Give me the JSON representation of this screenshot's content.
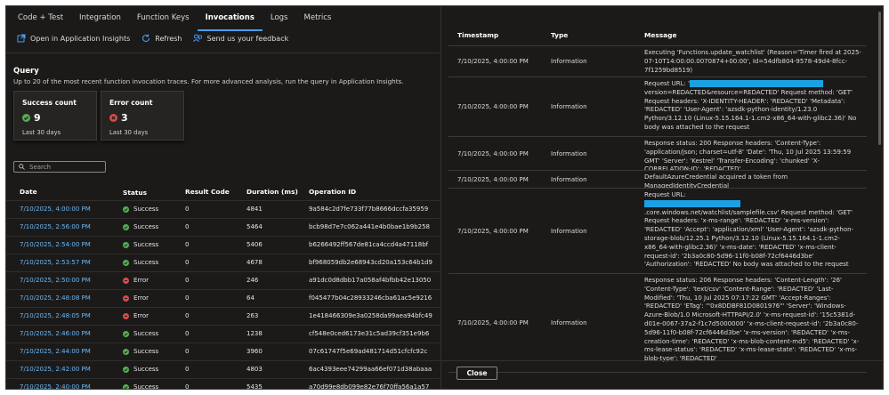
{
  "tabs": [
    "Code + Test",
    "Integration",
    "Function Keys",
    "Invocations",
    "Logs",
    "Metrics"
  ],
  "active_tab": 3,
  "toolbar": {
    "open_insights": "Open in Application Insights",
    "refresh": "Refresh",
    "feedback": "Send us your feedback"
  },
  "query": {
    "title": "Query",
    "description": "Up to 20 of the most recent function invocation traces. For more advanced analysis, run the query in Application Insights."
  },
  "cards": {
    "success": {
      "title": "Success count",
      "count": "9",
      "foot": "Last 30 days"
    },
    "error": {
      "title": "Error count",
      "count": "3",
      "foot": "Last 30 days"
    }
  },
  "search": {
    "placeholder": "Search"
  },
  "invocations": {
    "headers": [
      "Date",
      "Status",
      "Result Code",
      "Duration (ms)",
      "Operation ID"
    ],
    "rows": [
      {
        "date": "7/10/2025, 4:00:00 PM",
        "status": "Success",
        "code": "0",
        "duration": "4841",
        "op": "9a584c2d7fe733f77b8666dccfa35959"
      },
      {
        "date": "7/10/2025, 2:56:00 PM",
        "status": "Success",
        "code": "0",
        "duration": "5464",
        "op": "bcb98d7e7c062a441e4b0bae1b9b258"
      },
      {
        "date": "7/10/2025, 2:54:00 PM",
        "status": "Success",
        "code": "0",
        "duration": "5406",
        "op": "b6266492ff567de81ca4ccd4a47118bf"
      },
      {
        "date": "7/10/2025, 2:53:57 PM",
        "status": "Success",
        "code": "0",
        "duration": "4678",
        "op": "bf968059db2e68943cd20a153c64b1d9"
      },
      {
        "date": "7/10/2025, 2:50:00 PM",
        "status": "Error",
        "code": "0",
        "duration": "246",
        "op": "a91dc0d8dbb17a058af4bfbb42e13050"
      },
      {
        "date": "7/10/2025, 2:48:08 PM",
        "status": "Error",
        "code": "0",
        "duration": "64",
        "op": "f045477b04c28933246cba61ac5e9216"
      },
      {
        "date": "7/10/2025, 2:48:05 PM",
        "status": "Error",
        "code": "0",
        "duration": "263",
        "op": "1e418466309e3a0258da99aea94bfc49"
      },
      {
        "date": "7/10/2025, 2:46:00 PM",
        "status": "Success",
        "code": "0",
        "duration": "1238",
        "op": "cf548e0ced6173e31c5ad39cf351e9b6"
      },
      {
        "date": "7/10/2025, 2:44:00 PM",
        "status": "Success",
        "code": "0",
        "duration": "3960",
        "op": "07c61747f5e69ad481714d51cfcfc92c"
      },
      {
        "date": "7/10/2025, 2:42:00 PM",
        "status": "Success",
        "code": "0",
        "duration": "4803",
        "op": "6ac4393eee74299aa66ef071d38abaaa"
      },
      {
        "date": "7/10/2025, 2:40:00 PM",
        "status": "Success",
        "code": "0",
        "duration": "5435",
        "op": "a70d99e8db099e82e76f70ffa56a1a57"
      }
    ]
  },
  "colors": {
    "accent": "#479ef5",
    "link": "#6cb8f6",
    "success": "#54b054",
    "error": "#e04747",
    "redaction": "#1ba1e2"
  },
  "traces": {
    "headers": [
      "Timestamp",
      "Type",
      "Message"
    ],
    "rows": [
      {
        "ts": "7/10/2025, 4:00:00 PM",
        "type": "Information",
        "msg": "Executing 'Functions.update_watchlist' (Reason='Timer fired at 2025-07-10T14:00:00.0070874+00:00', Id=54dfb804-9578-49d4-8fcc-7f1259bd8519)"
      },
      {
        "ts": "7/10/2025, 4:00:00 PM",
        "type": "Information",
        "msg_pre": "Request URL: '",
        "msg": "version=REDACTED&resource=REDACTED' Request method: 'GET' Request headers: 'X-IDENTITY-HEADER': 'REDACTED' 'Metadata': 'REDACTED' 'User-Agent': 'azsdk-python-identity/1.23.0 Python/3.12.10 (Linux-5.15.164.1-1.cm2-x86_64-with-glibc2.36)' No body was attached to the request"
      },
      {
        "ts": "7/10/2025, 4:00:00 PM",
        "type": "Information",
        "msg": "Response status: 200 Response headers: 'Content-Type': 'application/json; charset=utf-8' 'Date': 'Thu, 10 Jul 2025 13:59:59 GMT' 'Server': 'Kestrel' 'Transfer-Encoding': 'chunked' 'X-CORRELATION-ID': 'REDACTED'"
      },
      {
        "ts": "7/10/2025, 4:00:00 PM",
        "type": "Information",
        "msg": "DefaultAzureCredential acquired a token from ManagedIdentityCredential"
      },
      {
        "ts": "7/10/2025, 4:00:00 PM",
        "type": "Information",
        "msg_pre": "Request URL:",
        "msg_tail": ".core.windows.net/watchlist/samplefile.csv' Request method: 'GET' Request headers: 'x-ms-range': 'REDACTED' 'x-ms-version': 'REDACTED' 'Accept': 'application/xml' 'User-Agent': 'azsdk-python-storage-blob/12.25.1 Python/3.12.10 (Linux-5.15.164.1-1.cm2-x86_64-with-glibc2.36)' 'x-ms-date': 'REDACTED' 'x-ms-client-request-id': '2b3a0c80-5d96-11f0-b08f-72cf6446d3be' 'Authorization': 'REDACTED' No body was attached to the request"
      },
      {
        "ts": "7/10/2025, 4:00:00 PM",
        "type": "Information",
        "msg": "Response status: 206 Response headers: 'Content-Length': '26' 'Content-Type': 'text/csv' 'Content-Range': 'REDACTED' 'Last-Modified': 'Thu, 10 Jul 2025 07:17:22 GMT' 'Accept-Ranges': 'REDACTED' 'ETag': '\"0x8DDBF81D0801976\"' 'Server': 'Windows-Azure-Blob/1.0 Microsoft-HTTPAPI/2.0' 'x-ms-request-id': '15c5381d-d01e-0067-37a2-f1c7d5000000' 'x-ms-client-request-id': '2b3a0c80-5d96-11f0-b08f-72cf6446d3be' 'x-ms-version': 'REDACTED' 'x-ms-creation-time': 'REDACTED' 'x-ms-blob-content-md5': 'REDACTED' 'x-ms-lease-status': 'REDACTED' 'x-ms-lease-state': 'REDACTED' 'x-ms-blob-type': 'REDACTED'"
      }
    ]
  },
  "close_label": "Close"
}
